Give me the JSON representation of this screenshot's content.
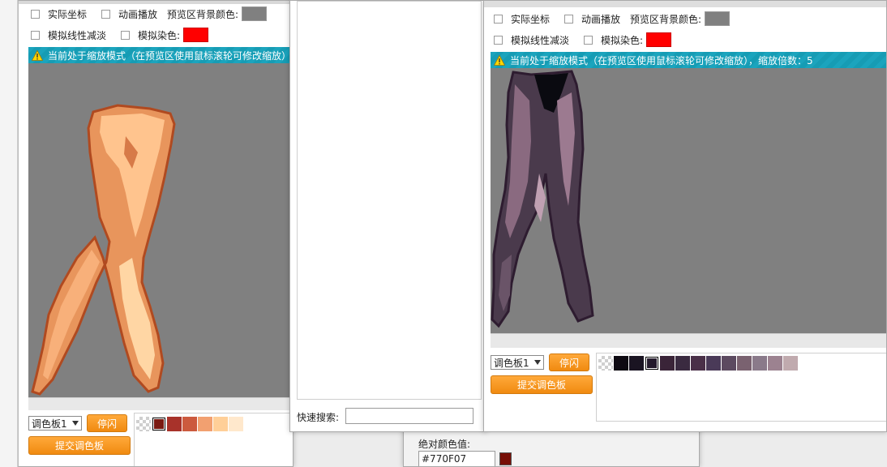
{
  "left_panel": {
    "option_real_coords": "实际坐标",
    "option_anim_play": "动画播放",
    "bg_color_label": "预览区背景颜色:",
    "bg_color": "#808080",
    "option_linear_fade": "模拟线性减淡",
    "tint_label": "模拟染色:",
    "tint_color": "#ff0000",
    "warning": "当前处于缩放模式（在预览区使用鼠标滚轮可修改缩放）",
    "palette_select": "调色板1",
    "stop_flash": "停闪",
    "submit_palette": "提交调色板",
    "palette_colors": [
      "transparent",
      "#7a1a12",
      "#a8322a",
      "#cc5a3e",
      "#f2a070",
      "#ffcf98",
      "#ffe8cc"
    ]
  },
  "middle_panel": {
    "quick_search_label": "快速搜索:",
    "quick_search_value": "",
    "abs_color_label": "绝对颜色值:",
    "abs_color_value": "#770F07",
    "abs_color": "#770F07"
  },
  "right_panel": {
    "option_real_coords": "实际坐标",
    "option_anim_play": "动画播放",
    "bg_color_label": "预览区背景颜色:",
    "bg_color": "#808080",
    "option_linear_fade": "模拟线性减淡",
    "tint_label": "模拟染色:",
    "tint_color": "#ff0000",
    "warning": "当前处于缩放模式（在预览区使用鼠标滚轮可修改缩放），缩放倍数：5",
    "palette_select": "调色板1",
    "stop_flash": "停闪",
    "submit_palette": "提交调色板",
    "palette_colors": [
      "transparent",
      "#0e0a12",
      "#1a1422",
      "#241a2c",
      "#3a2438",
      "#3a2a40",
      "#4a3048",
      "#4a3a58",
      "#5c4a60",
      "#7a6270",
      "#8a7a8a",
      "#9c8290",
      "#c0aaae"
    ]
  }
}
